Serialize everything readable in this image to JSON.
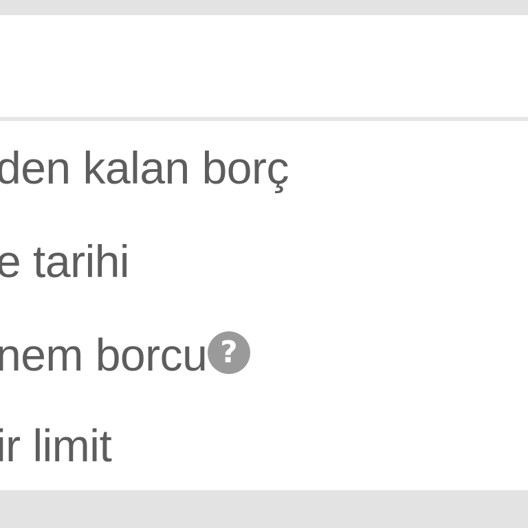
{
  "rows": [
    {
      "label": "den kalan borç"
    },
    {
      "label": "e tarihi"
    },
    {
      "label": "nem borcu"
    },
    {
      "label": "ir limit"
    }
  ],
  "help_icon": {
    "glyph": "?",
    "icon": "question-circle-icon"
  },
  "colors": {
    "text": "#5d5d5d",
    "icon_bg": "#9a9a9a",
    "background": "#e3e3e3",
    "card": "#ffffff"
  }
}
